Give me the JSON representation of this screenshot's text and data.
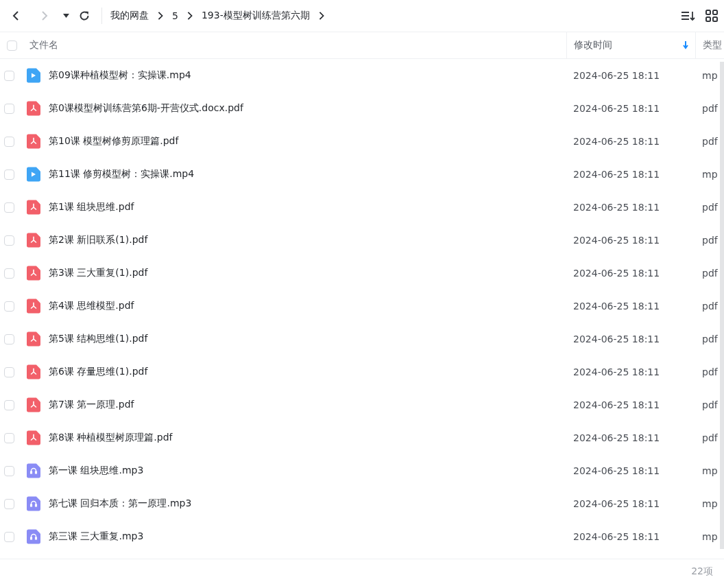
{
  "toolbar": {
    "back_disabled": false,
    "forward_disabled": true,
    "breadcrumbs": [
      "我的网盘",
      "5",
      "193-模型树训练营第六期"
    ]
  },
  "table": {
    "columns": [
      {
        "label": "文件名",
        "sorted": false
      },
      {
        "label": "修改时间",
        "sorted": true
      },
      {
        "label": "类型",
        "sorted": false
      }
    ],
    "all_checked": false,
    "rows": [
      {
        "kind": "video",
        "name": "第09课种植模型树：实操课.mp4",
        "modified": "2024-06-25 18:11",
        "type": "mp",
        "checked": false
      },
      {
        "kind": "pdf",
        "name": "第0课模型树训练营第6期-开营仪式.docx.pdf",
        "modified": "2024-06-25 18:11",
        "type": "pdf",
        "checked": false
      },
      {
        "kind": "pdf",
        "name": "第10课 模型树修剪原理篇.pdf",
        "modified": "2024-06-25 18:11",
        "type": "pdf",
        "checked": false
      },
      {
        "kind": "video",
        "name": "第11课 修剪模型树：实操课.mp4",
        "modified": "2024-06-25 18:11",
        "type": "mp",
        "checked": false
      },
      {
        "kind": "pdf",
        "name": "第1课 组块思维.pdf",
        "modified": "2024-06-25 18:11",
        "type": "pdf",
        "checked": false
      },
      {
        "kind": "pdf",
        "name": "第2课 新旧联系(1).pdf",
        "modified": "2024-06-25 18:11",
        "type": "pdf",
        "checked": false
      },
      {
        "kind": "pdf",
        "name": "第3课 三大重复(1).pdf",
        "modified": "2024-06-25 18:11",
        "type": "pdf",
        "checked": false
      },
      {
        "kind": "pdf",
        "name": "第4课 思维模型.pdf",
        "modified": "2024-06-25 18:11",
        "type": "pdf",
        "checked": false
      },
      {
        "kind": "pdf",
        "name": "第5课 结构思维(1).pdf",
        "modified": "2024-06-25 18:11",
        "type": "pdf",
        "checked": false
      },
      {
        "kind": "pdf",
        "name": "第6课 存量思维(1).pdf",
        "modified": "2024-06-25 18:11",
        "type": "pdf",
        "checked": false
      },
      {
        "kind": "pdf",
        "name": "第7课 第一原理.pdf",
        "modified": "2024-06-25 18:11",
        "type": "pdf",
        "checked": false
      },
      {
        "kind": "pdf",
        "name": "第8课 种植模型树原理篇.pdf",
        "modified": "2024-06-25 18:11",
        "type": "pdf",
        "checked": false
      },
      {
        "kind": "audio",
        "name": "第一课 组块思维.mp3",
        "modified": "2024-06-25 18:11",
        "type": "mp",
        "checked": false
      },
      {
        "kind": "audio",
        "name": "第七课 回归本质：第一原理.mp3",
        "modified": "2024-06-25 18:11",
        "type": "mp",
        "checked": false
      },
      {
        "kind": "audio",
        "name": "第三课 三大重复.mp3",
        "modified": "2024-06-25 18:11",
        "type": "mp",
        "checked": false
      }
    ]
  },
  "status_bar": {
    "count": "22项"
  }
}
